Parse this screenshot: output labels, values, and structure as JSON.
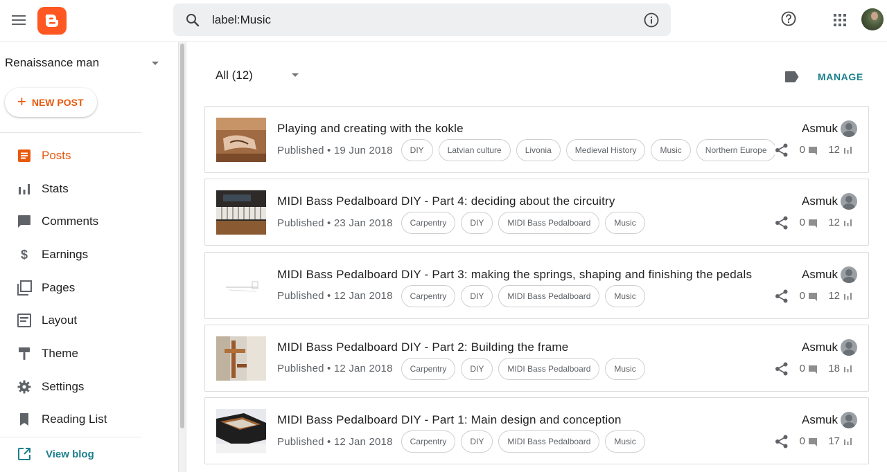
{
  "search": {
    "value": "label:Music"
  },
  "blog": {
    "name": "Renaissance man"
  },
  "new_post_label": "NEW POST",
  "nav": [
    {
      "label": "Posts",
      "icon": "posts-icon",
      "active": true
    },
    {
      "label": "Stats",
      "icon": "stats-icon"
    },
    {
      "label": "Comments",
      "icon": "comments-icon"
    },
    {
      "label": "Earnings",
      "icon": "earnings-icon"
    },
    {
      "label": "Pages",
      "icon": "pages-icon"
    },
    {
      "label": "Layout",
      "icon": "layout-icon"
    },
    {
      "label": "Theme",
      "icon": "theme-icon"
    },
    {
      "label": "Settings",
      "icon": "settings-icon"
    },
    {
      "label": "Reading List",
      "icon": "reading-list-icon"
    }
  ],
  "view_blog_label": "View blog",
  "filter": {
    "label": "All (12)"
  },
  "manage_label": "MANAGE",
  "colors": {
    "accent": "#e8590c",
    "teal": "#1a7f8c"
  },
  "posts": [
    {
      "title": "Playing and creating with the kokle",
      "published": "Published • 19 Jun 2018",
      "labels": [
        "DIY",
        "Latvian culture",
        "Livonia",
        "Medieval History",
        "Music",
        "Northern Europe"
      ],
      "author": "Asmuk",
      "comments": "0",
      "views": "12",
      "thumb": "kokle"
    },
    {
      "title": "MIDI Bass Pedalboard DIY - Part 4: deciding about the circuitry",
      "published": "Published • 23 Jan 2018",
      "labels": [
        "Carpentry",
        "DIY",
        "MIDI Bass Pedalboard",
        "Music"
      ],
      "author": "Asmuk",
      "comments": "0",
      "views": "12",
      "thumb": "keyboard"
    },
    {
      "title": "MIDI Bass Pedalboard DIY - Part 3: making the springs, shaping and finishing the pedals",
      "published": "Published • 12 Jan 2018",
      "labels": [
        "Carpentry",
        "DIY",
        "MIDI Bass Pedalboard",
        "Music"
      ],
      "author": "Asmuk",
      "comments": "0",
      "views": "12",
      "thumb": "sketch"
    },
    {
      "title": "MIDI Bass Pedalboard DIY - Part 2: Building the frame",
      "published": "Published • 12 Jan 2018",
      "labels": [
        "Carpentry",
        "DIY",
        "MIDI Bass Pedalboard",
        "Music"
      ],
      "author": "Asmuk",
      "comments": "0",
      "views": "18",
      "thumb": "frame"
    },
    {
      "title": "MIDI Bass Pedalboard DIY - Part 1: Main design and conception",
      "published": "Published • 12 Jan 2018",
      "labels": [
        "Carpentry",
        "DIY",
        "MIDI Bass Pedalboard",
        "Music"
      ],
      "author": "Asmuk",
      "comments": "0",
      "views": "17",
      "thumb": "box"
    }
  ]
}
